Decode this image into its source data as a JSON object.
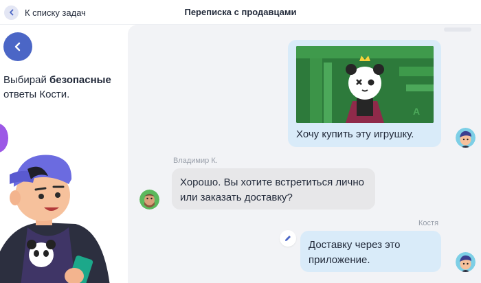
{
  "header": {
    "back_label": "К списку задач",
    "title": "Переписка с продавцами"
  },
  "left": {
    "instruction_prefix": "Выбирай ",
    "instruction_bold": "безопасные",
    "instruction_suffix": "ответы Кости."
  },
  "chat": {
    "messages": [
      {
        "sender": "",
        "text": "Хочу купить эту игрушку.",
        "has_image": true,
        "image_icon": "panda-toy-image"
      },
      {
        "sender": "Владимир К.",
        "text": "Хорошо. Вы хотите встретиться лично или заказать доставку?"
      },
      {
        "sender": "Костя",
        "text": "Доставку через это приложение."
      }
    ]
  },
  "colors": {
    "accent": "#4b66c6",
    "purple": "#9c58e6",
    "bubble_out": "#d9ebf9",
    "bubble_in": "#e7e7e9",
    "chat_bg": "#f2f3f6"
  },
  "icons": {
    "back": "chevron-left-icon",
    "edit": "pencil-icon"
  }
}
